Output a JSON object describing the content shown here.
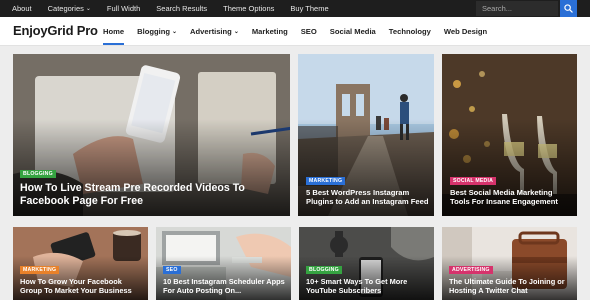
{
  "topbar": {
    "items": [
      {
        "label": "About"
      },
      {
        "label": "Categories",
        "has_dropdown": true
      },
      {
        "label": "Full Width"
      },
      {
        "label": "Search Results"
      },
      {
        "label": "Theme Options"
      },
      {
        "label": "Buy Theme"
      }
    ],
    "search_placeholder": "Search..."
  },
  "header": {
    "logo": "EnjoyGrid Pro",
    "nav": [
      {
        "label": "Home",
        "active": true
      },
      {
        "label": "Blogging",
        "has_dropdown": true
      },
      {
        "label": "Advertising",
        "has_dropdown": true
      },
      {
        "label": "Marketing"
      },
      {
        "label": "SEO"
      },
      {
        "label": "Social Media"
      },
      {
        "label": "Technology"
      },
      {
        "label": "Web Design"
      }
    ],
    "accent_color": "#2a6fd6"
  },
  "posts": [
    {
      "category": "BLOGGING",
      "category_color": "#35a341",
      "title": "How To Live Stream Pre Recorded Videos To Facebook Page For Free"
    },
    {
      "category": "MARKETING",
      "category_color": "#2a6fd6",
      "title": "5 Best WordPress Instagram Plugins to Add an Instagram Feed"
    },
    {
      "category": "SOCIAL MEDIA",
      "category_color": "#d6336c",
      "title": "Best Social Media Marketing Tools For Insane Engagement"
    },
    {
      "category": "MARKETING",
      "category_color": "#e8812a",
      "title": "How To Grow Your Facebook Group To Market Your Business"
    },
    {
      "category": "SEO",
      "category_color": "#2a6fd6",
      "title": "10 Best Instagram Scheduler Apps For Auto Posting On..."
    },
    {
      "category": "BLOGGING",
      "category_color": "#35a341",
      "title": "10+ Smart Ways To Get More YouTube Subscribers"
    },
    {
      "category": "ADVERTISING",
      "category_color": "#d6336c",
      "title": "The Ultimate Guide To Joining or Hosting A Twitter Chat"
    }
  ]
}
